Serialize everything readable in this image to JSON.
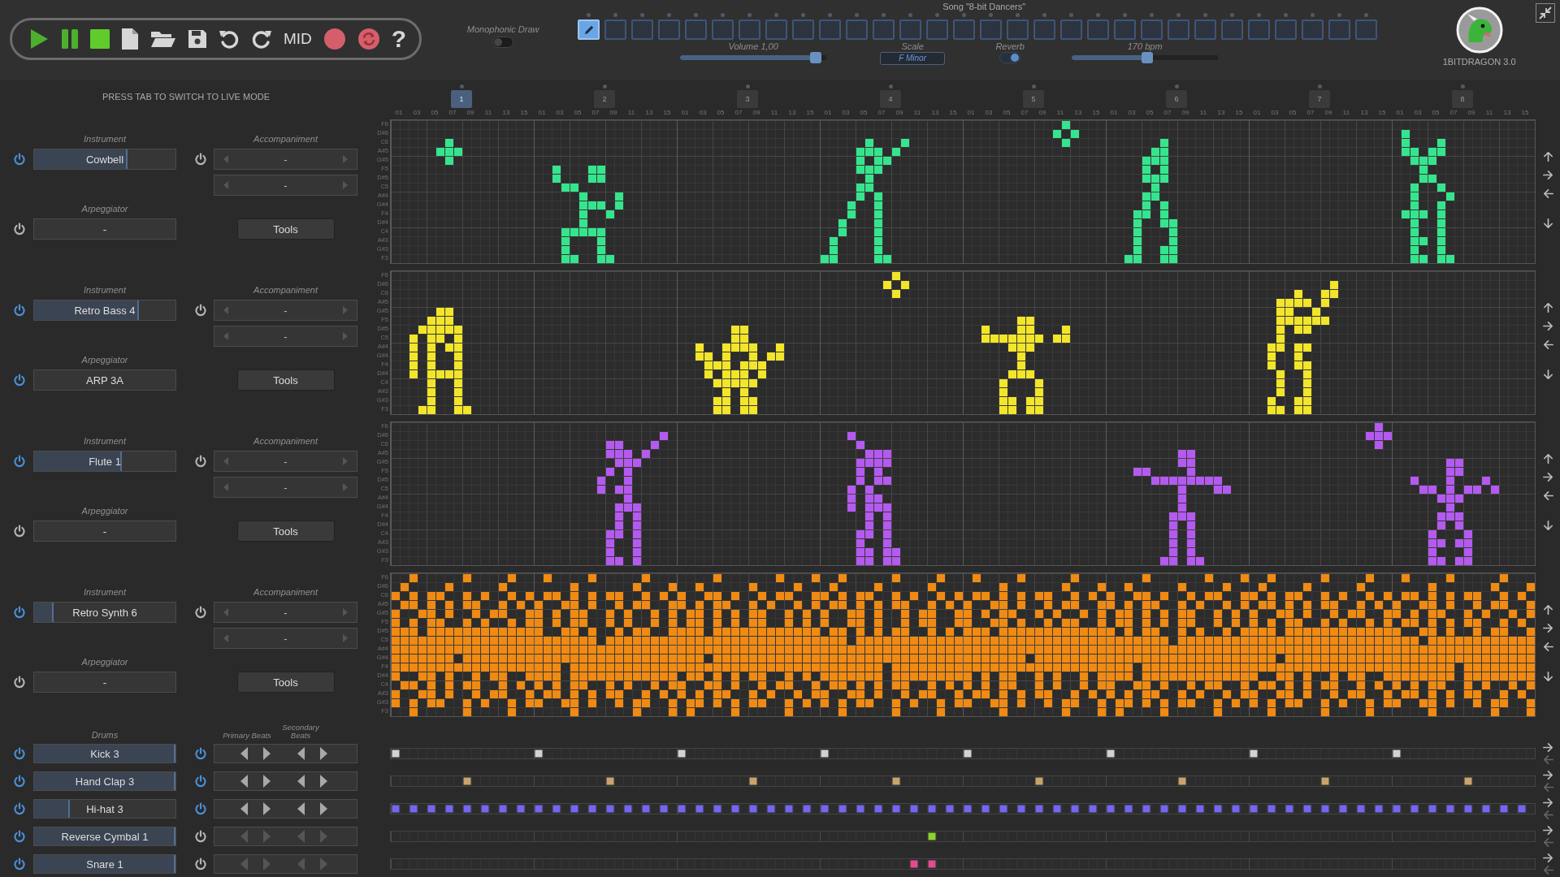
{
  "header": {
    "toolbar": {
      "mid_label": "MID",
      "help_glyph": "?"
    },
    "monophonic": {
      "label": "Monophonic Draw",
      "on": false
    },
    "song_title": "Song \"8-bit Dancers\"",
    "pattern_slots": [
      {
        "selected": true
      },
      {
        "selected": false
      },
      {
        "selected": false
      },
      {
        "selected": false
      },
      {
        "selected": false
      },
      {
        "selected": false
      },
      {
        "selected": false
      },
      {
        "selected": false
      },
      {
        "selected": false
      },
      {
        "selected": false
      },
      {
        "selected": false
      },
      {
        "selected": false
      },
      {
        "selected": false
      },
      {
        "selected": false
      },
      {
        "selected": false
      },
      {
        "selected": false
      },
      {
        "selected": false
      },
      {
        "selected": false
      },
      {
        "selected": false
      },
      {
        "selected": false
      },
      {
        "selected": false
      },
      {
        "selected": false
      },
      {
        "selected": false
      },
      {
        "selected": false
      },
      {
        "selected": false
      },
      {
        "selected": false
      },
      {
        "selected": false
      },
      {
        "selected": false
      },
      {
        "selected": false
      },
      {
        "selected": false
      }
    ],
    "volume": {
      "label": "Volume 1,00",
      "level": 0.93
    },
    "scale": {
      "label": "Scale",
      "value": "F Minor"
    },
    "reverb": {
      "label": "Reverb",
      "on": true
    },
    "tempo": {
      "label": "170 bpm",
      "level": 0.52
    },
    "logo_caption": "1BITDRAGON 3.0"
  },
  "hint": "PRESS TAB TO SWITCH TO LIVE MODE",
  "bars": [
    {
      "label": "1",
      "selected": true,
      "steps": [
        "01",
        "03",
        "05",
        "07",
        "09",
        "11",
        "13",
        "15"
      ]
    },
    {
      "label": "2",
      "selected": false,
      "steps": [
        "01",
        "03",
        "05",
        "07",
        "09",
        "11",
        "13",
        "15"
      ]
    },
    {
      "label": "3",
      "selected": false,
      "steps": [
        "01",
        "03",
        "05",
        "07",
        "09",
        "11",
        "13",
        "15"
      ]
    },
    {
      "label": "4",
      "selected": false,
      "steps": [
        "01",
        "03",
        "05",
        "07",
        "09",
        "11",
        "13",
        "15"
      ]
    },
    {
      "label": "5",
      "selected": false,
      "steps": [
        "01",
        "03",
        "05",
        "07",
        "09",
        "11",
        "13",
        "15"
      ]
    },
    {
      "label": "6",
      "selected": false,
      "steps": [
        "01",
        "03",
        "05",
        "07",
        "09",
        "11",
        "13",
        "15"
      ]
    },
    {
      "label": "7",
      "selected": false,
      "steps": [
        "01",
        "03",
        "05",
        "07",
        "09",
        "11",
        "13",
        "15"
      ]
    },
    {
      "label": "8",
      "selected": false,
      "steps": [
        "01",
        "03",
        "05",
        "07",
        "09",
        "11",
        "13",
        "15"
      ]
    }
  ],
  "tracks": [
    {
      "instrument_label": "Instrument",
      "instrument": {
        "name": "Cowbell",
        "on": true,
        "level": 0.66
      },
      "arpeggiator_label": "Arpeggiator",
      "arpeggiator": {
        "value": "-",
        "on": false
      },
      "accompaniment_label": "Accompaniment",
      "accompaniment": {
        "on": false,
        "values": [
          "-",
          "-"
        ]
      },
      "tools": "Tools",
      "color": "#35e58e",
      "note_labels": [
        "F6",
        "D#6",
        "C6",
        "A#5",
        "G#5",
        "F5",
        "D#5",
        "C5",
        "A#4",
        "G#4",
        "F4",
        "D#4",
        "C4",
        "A#3",
        "G#3",
        "F3"
      ]
    },
    {
      "instrument_label": "Instrument",
      "instrument": {
        "name": "Retro Bass 4",
        "on": true,
        "level": 0.74
      },
      "arpeggiator_label": "Arpeggiator",
      "arpeggiator": {
        "value": "ARP 3A",
        "on": true
      },
      "accompaniment_label": "Accompaniment",
      "accompaniment": {
        "on": false,
        "values": [
          "-",
          "-"
        ]
      },
      "tools": "Tools",
      "color": "#f2e52a",
      "note_labels": [
        "F6",
        "D#6",
        "C6",
        "A#5",
        "G#5",
        "F5",
        "D#5",
        "C5",
        "A#4",
        "G#4",
        "F4",
        "D#4",
        "C4",
        "A#3",
        "G#3",
        "F3"
      ]
    },
    {
      "instrument_label": "Instrument",
      "instrument": {
        "name": "Flute 1",
        "on": true,
        "level": 0.62
      },
      "arpeggiator_label": "Arpeggiator",
      "arpeggiator": {
        "value": "-",
        "on": false
      },
      "accompaniment_label": "Accompaniment",
      "accompaniment": {
        "on": false,
        "values": [
          "-",
          "-"
        ]
      },
      "tools": "Tools",
      "color": "#b45af0",
      "note_labels": [
        "F6",
        "D#6",
        "C6",
        "A#5",
        "G#5",
        "F5",
        "D#5",
        "C5",
        "A#4",
        "G#4",
        "F4",
        "D#4",
        "C4",
        "A#3",
        "G#3",
        "F3"
      ]
    },
    {
      "instrument_label": "Instrument",
      "instrument": {
        "name": "Retro Synth 6",
        "on": true,
        "level": 0.14
      },
      "arpeggiator_label": "Arpeggiator",
      "arpeggiator": {
        "value": "-",
        "on": false
      },
      "accompaniment_label": "Accompaniment",
      "accompaniment": {
        "on": false,
        "values": [
          "-",
          "-"
        ]
      },
      "tools": "Tools",
      "color": "#f08a12",
      "note_labels": [
        "F6",
        "D#6",
        "C6",
        "A#5",
        "G#5",
        "F5",
        "D#5",
        "C5",
        "A#4",
        "G#4",
        "F4",
        "D#4",
        "C4",
        "A#3",
        "G#3",
        "F3"
      ]
    }
  ],
  "drums": {
    "label": "Drums",
    "primary_label": "Primary Beats",
    "secondary_label": "Secondary Beats",
    "tracks": [
      {
        "name": "Kick 3",
        "on": true,
        "level": 1,
        "beats_on": true,
        "color": "#d2d2d2"
      },
      {
        "name": "Hand Clap 3",
        "on": true,
        "level": 1,
        "beats_on": true,
        "color": "#c9a36e"
      },
      {
        "name": "Hi-hat 3",
        "on": true,
        "level": 0.25,
        "beats_on": true,
        "color": "#7466ee"
      },
      {
        "name": "Reverse Cymbal 1",
        "on": true,
        "level": 1,
        "beats_on": false,
        "color": "#8cd232"
      },
      {
        "name": "Snare 1",
        "on": true,
        "level": 1,
        "beats_on": false,
        "color": "#e04c8c"
      }
    ]
  }
}
